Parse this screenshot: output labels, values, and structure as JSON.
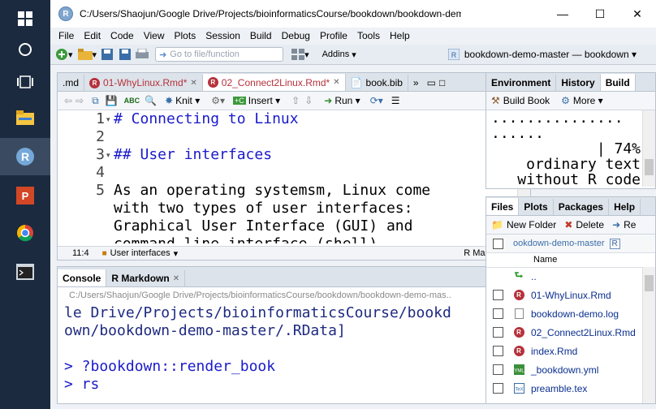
{
  "window": {
    "title": "C:/Users/Shaojun/Google Drive/Projects/bioinformaticsCourse/bookdown/bookdown-demo-master - RStudio",
    "title_shown": "C:/Users/Shaojun/Google Drive/Projects/bioinformaticsCourse/bookdown/bookdown-demo-master - RSt..."
  },
  "menu": [
    "File",
    "Edit",
    "Code",
    "View",
    "Plots",
    "Session",
    "Build",
    "Debug",
    "Profile",
    "Tools",
    "Help"
  ],
  "toolbar": {
    "goto_placeholder": "Go to file/function",
    "addins": "Addins",
    "project": "bookdown-demo-master — bookdown"
  },
  "editor": {
    "tabs": [
      {
        "label": ".md"
      },
      {
        "label": "01-WhyLinux.Rmd*"
      },
      {
        "label": "02_Connect2Linux.Rmd*"
      },
      {
        "label": "book.bib"
      }
    ],
    "buttons": {
      "knit": "Knit",
      "insert": "Insert",
      "run": "Run"
    },
    "lines": [
      {
        "num": "1",
        "text": "# Connecting to Linux",
        "heading": true
      },
      {
        "num": "2",
        "text": "",
        "heading": false
      },
      {
        "num": "3",
        "text": "## User interfaces",
        "heading": true
      },
      {
        "num": "4",
        "text": "",
        "heading": false
      },
      {
        "num": "5",
        "text": "As an operating systemsm, Linux come",
        "heading": false
      },
      {
        "num": "",
        "text": "with two types of user interfaces:",
        "heading": false
      },
      {
        "num": "",
        "text": "Graphical User Interface (GUI) and",
        "heading": false
      },
      {
        "num": "",
        "text": "command line interface (shell).",
        "heading": false
      }
    ],
    "status": {
      "position": "11:4",
      "section": "User interfaces",
      "mode": "R Markdown"
    }
  },
  "console": {
    "tabs": [
      "Console",
      "R Markdown"
    ],
    "path": "C:/Users/Shaojun/Google Drive/Projects/bioinformaticsCourse/bookdown/bookdown-demo-mas...",
    "lines": [
      "le Drive/Projects/bioinformaticsCourse/bookd",
      "own/bookdown-demo-master/.RData]",
      "",
      "> ?bookdown::render_book",
      "> rs"
    ]
  },
  "env": {
    "tabs": [
      "Environment",
      "History",
      "Build"
    ],
    "build_book": "Build Book",
    "more": "More",
    "output": [
      "...............",
      "......",
      "|  74%",
      "ordinary text",
      "without R code"
    ]
  },
  "files": {
    "tabs": [
      "Files",
      "Plots",
      "Packages",
      "Help"
    ],
    "new_folder": "New Folder",
    "delete": "Delete",
    "rename": "Re",
    "path": "ookdown-demo-master",
    "header_name": "Name",
    "up": "..",
    "items": [
      {
        "name": "01-WhyLinux.Rmd",
        "icon": "rmd-icon"
      },
      {
        "name": "bookdown-demo.log",
        "icon": "file-icon"
      },
      {
        "name": "02_Connect2Linux.Rmd",
        "icon": "rmd-icon"
      },
      {
        "name": "index.Rmd",
        "icon": "rmd-icon"
      },
      {
        "name": "_bookdown.yml",
        "icon": "yml-icon"
      },
      {
        "name": "preamble.tex",
        "icon": "tex-icon"
      }
    ]
  },
  "colors": {
    "heading": "#1a1acc",
    "rmd": "#b5323c",
    "taskbar": "#1b2a3f"
  }
}
